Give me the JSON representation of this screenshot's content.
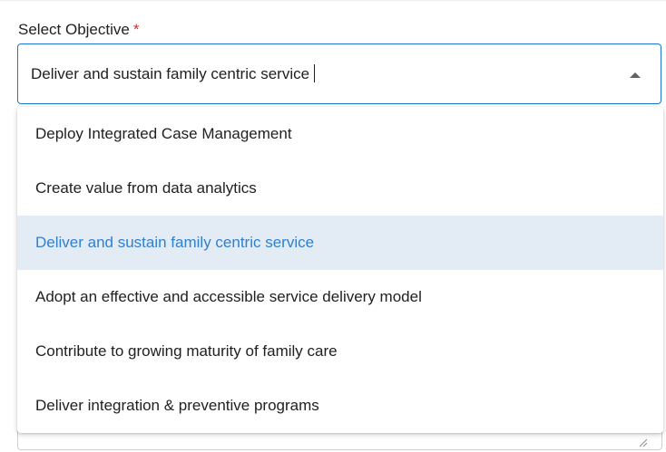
{
  "form": {
    "label": "Select Objective",
    "required_mark": "*",
    "selected_value": "Deliver and sustain family centric service"
  },
  "dropdown": {
    "options": [
      {
        "label": "Deploy Integrated Case Management",
        "selected": false
      },
      {
        "label": "Create value from data analytics",
        "selected": false
      },
      {
        "label": "Deliver and sustain family centric service",
        "selected": true
      },
      {
        "label": "Adopt an effective and accessible service delivery model",
        "selected": false
      },
      {
        "label": "Contribute to growing maturity of family care",
        "selected": false
      },
      {
        "label": "Deliver integration & preventive programs",
        "selected": false
      }
    ]
  },
  "colors": {
    "focus_border": "#1976d2",
    "selected_option_bg": "#e3ebf5",
    "selected_option_text": "#2f80cf",
    "required_mark": "#d32f2f"
  },
  "icons": {
    "dropdown_toggle": "arrow-up-icon",
    "textarea_resize": "resize-handle-icon"
  }
}
